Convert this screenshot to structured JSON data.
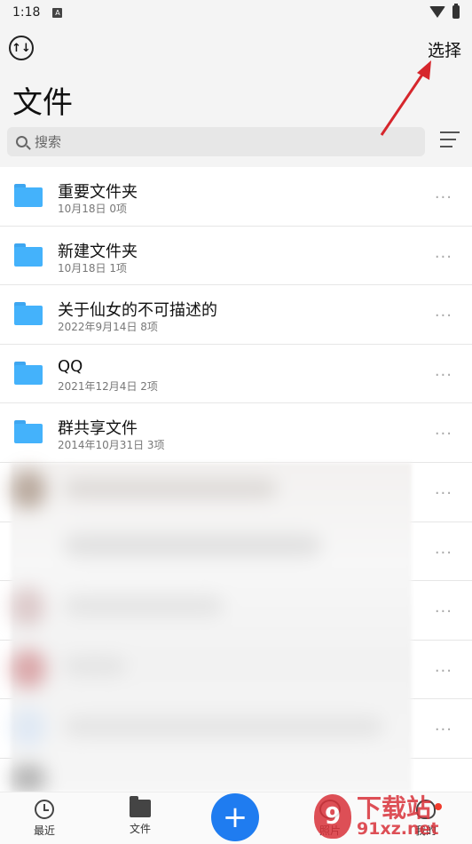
{
  "status_bar": {
    "time": "1:18",
    "indicator": "A"
  },
  "header": {
    "sort_icon_label": "↑↓",
    "select_label": "选择",
    "title": "文件",
    "search_placeholder": "搜索"
  },
  "files": [
    {
      "name": "重要文件夹",
      "date": "10月18日",
      "count": "0项"
    },
    {
      "name": "新建文件夹",
      "date": "10月18日",
      "count": "1项"
    },
    {
      "name": "关于仙女的不可描述的",
      "date": "2022年9月14日",
      "count": "8项"
    },
    {
      "name": "QQ",
      "date": "2021年12月4日",
      "count": "2项"
    },
    {
      "name": "群共享文件",
      "date": "2014年10月31日",
      "count": "3项"
    }
  ],
  "more_glyph": "···",
  "bottom_nav": {
    "recent": "最近",
    "files": "文件",
    "add": "+",
    "photos": "照片",
    "mine": "我的"
  },
  "watermark": {
    "logo": "9",
    "cn": "下载站",
    "url": "91xz.net"
  },
  "colors": {
    "accent": "#1f7cf0",
    "folder": "#44b2fb",
    "arrow": "#d6262c"
  }
}
